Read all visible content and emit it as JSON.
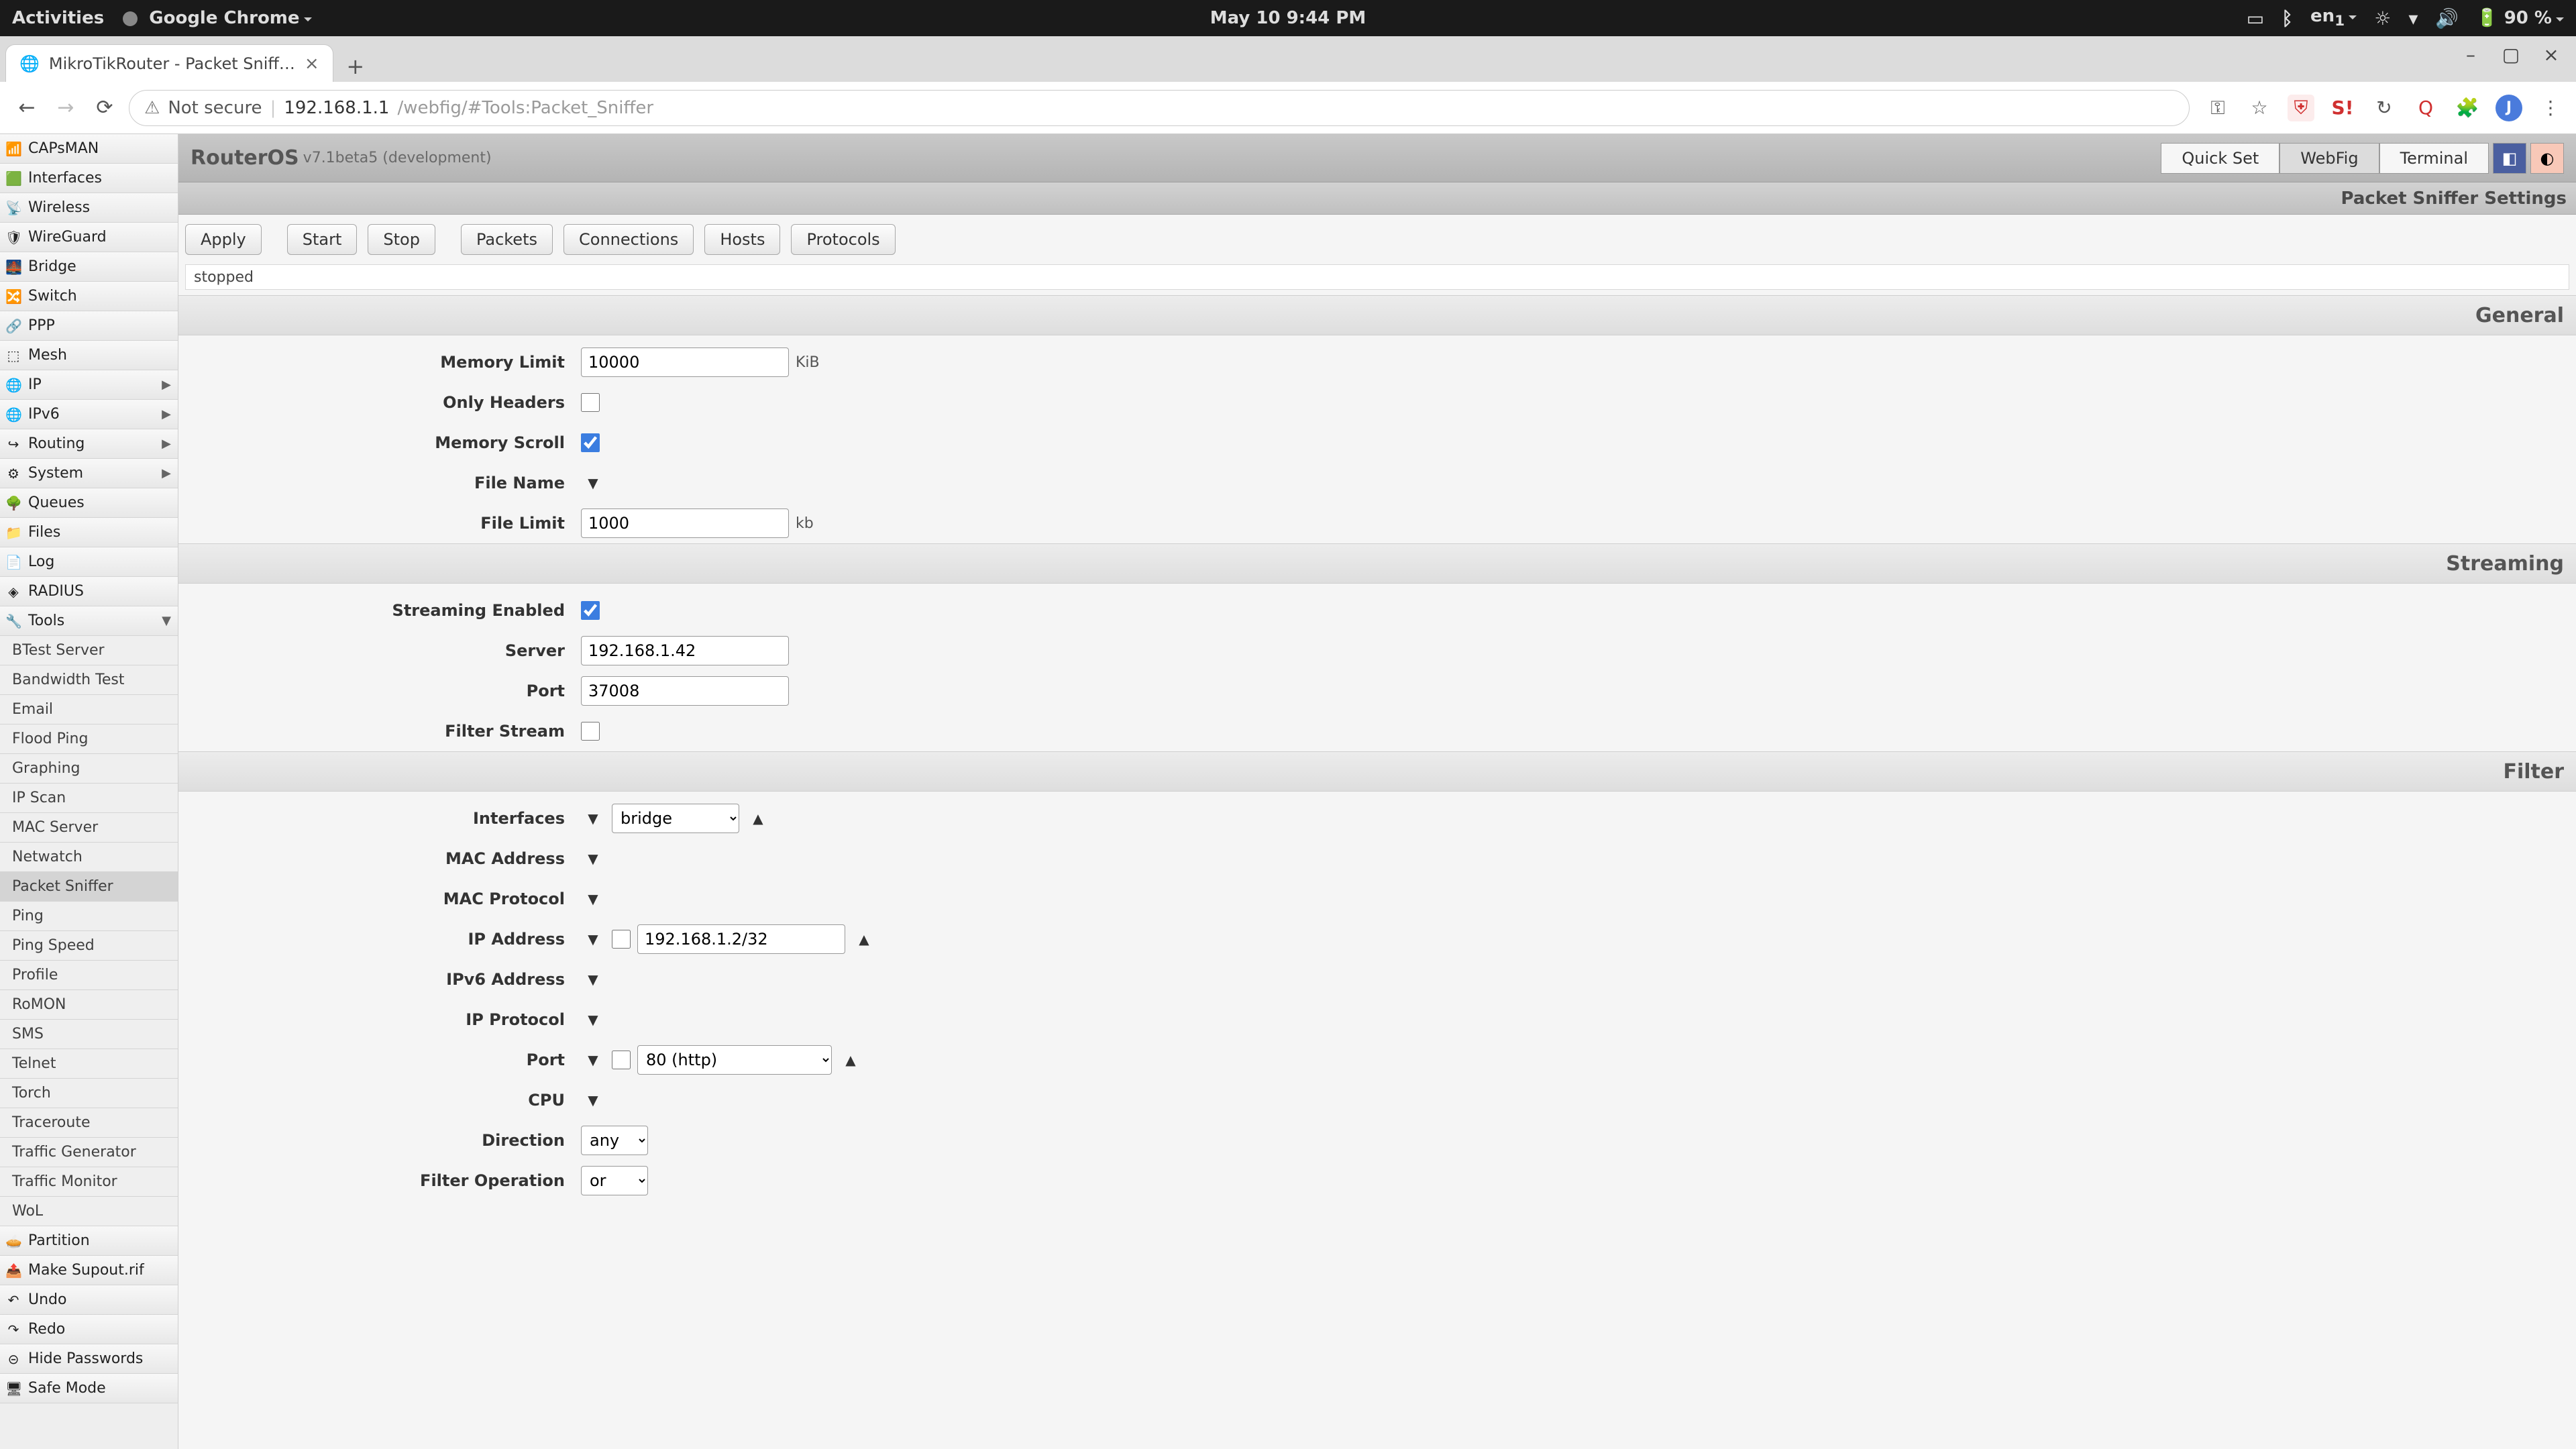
{
  "gnome": {
    "activities": "Activities",
    "app": "Google Chrome",
    "clock": "May 10  9:44 PM",
    "lang": "en",
    "lang_sub": "1",
    "battery": "90 %"
  },
  "browser": {
    "tab_title": "MikroTikRouter - Packet Sniff…",
    "security_label": "Not secure",
    "host": "192.168.1.1",
    "path": "/webfig/#Tools:Packet_Sniffer",
    "avatar_initial": "J"
  },
  "header": {
    "product": "RouterOS",
    "version": "v7.1beta5 (development)",
    "tabs": {
      "quickset": "Quick Set",
      "webfig": "WebFig",
      "terminal": "Terminal"
    }
  },
  "subheader": {
    "title": "Packet Sniffer Settings"
  },
  "toolbar": {
    "apply": "Apply",
    "start": "Start",
    "stop": "Stop",
    "packets": "Packets",
    "connections": "Connections",
    "hosts": "Hosts",
    "protocols": "Protocols"
  },
  "status": "stopped",
  "sidebar": {
    "main": [
      "CAPsMAN",
      "Interfaces",
      "Wireless",
      "WireGuard",
      "Bridge",
      "Switch",
      "PPP",
      "Mesh",
      "IP",
      "IPv6",
      "Routing",
      "System",
      "Queues",
      "Files",
      "Log",
      "RADIUS",
      "Tools",
      "Partition",
      "Make Supout.rif",
      "Undo",
      "Redo",
      "Hide Passwords",
      "Safe Mode"
    ],
    "tools_sub": [
      "BTest Server",
      "Bandwidth Test",
      "Email",
      "Flood Ping",
      "Graphing",
      "IP Scan",
      "MAC Server",
      "Netwatch",
      "Packet Sniffer",
      "Ping",
      "Ping Speed",
      "Profile",
      "RoMON",
      "SMS",
      "Telnet",
      "Torch",
      "Traceroute",
      "Traffic Generator",
      "Traffic Monitor",
      "WoL"
    ]
  },
  "sections": {
    "general": "General",
    "streaming": "Streaming",
    "filter": "Filter"
  },
  "labels": {
    "memory_limit": "Memory Limit",
    "only_headers": "Only Headers",
    "memory_scroll": "Memory Scroll",
    "file_name": "File Name",
    "file_limit": "File Limit",
    "streaming_enabled": "Streaming Enabled",
    "server": "Server",
    "port": "Port",
    "filter_stream": "Filter Stream",
    "interfaces": "Interfaces",
    "mac_address": "MAC Address",
    "mac_protocol": "MAC Protocol",
    "ip_address": "IP Address",
    "ipv6_address": "IPv6 Address",
    "ip_protocol": "IP Protocol",
    "f_port": "Port",
    "cpu": "CPU",
    "direction": "Direction",
    "filter_operation": "Filter Operation"
  },
  "values": {
    "memory_limit": "10000",
    "memory_limit_unit": "KiB",
    "only_headers": false,
    "memory_scroll": true,
    "file_limit": "1000",
    "file_limit_unit": "kb",
    "streaming_enabled": true,
    "server": "192.168.1.42",
    "port": "37008",
    "filter_stream": false,
    "interfaces": "bridge",
    "ip_address": "192.168.1.2/32",
    "f_port": "80 (http)",
    "direction": "any",
    "filter_operation": "or"
  }
}
